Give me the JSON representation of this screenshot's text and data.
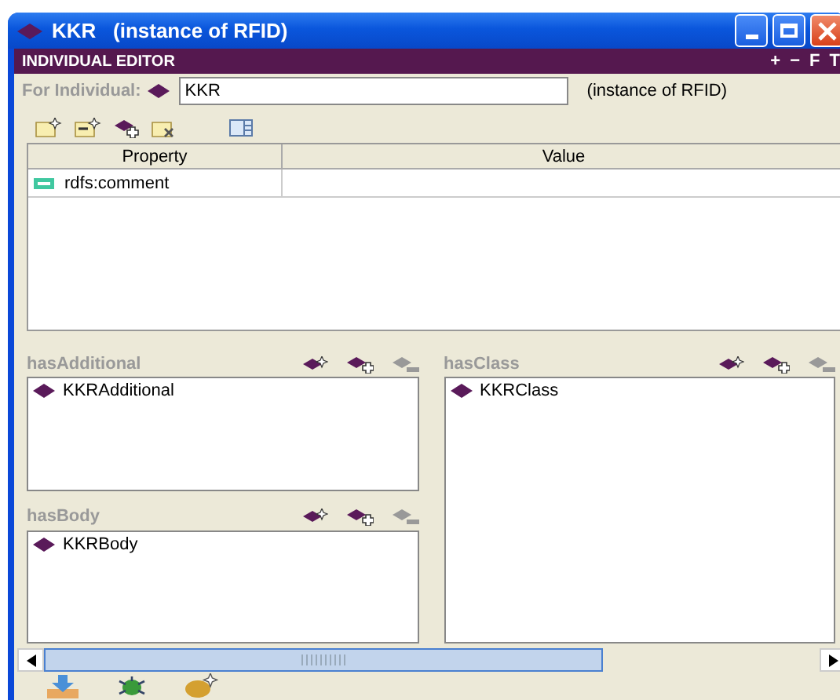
{
  "window": {
    "title": "KKR   (instance of RFID)"
  },
  "editor_header": {
    "title": "INDIVIDUAL EDITOR",
    "buttons": [
      "+",
      "−",
      "F",
      "T"
    ]
  },
  "individual": {
    "label": "For Individual:",
    "value": "KKR",
    "type_note": "(instance of RFID)"
  },
  "table": {
    "columns": [
      "Property",
      "Value"
    ],
    "rows": [
      {
        "property": "rdfs:comment",
        "value": ""
      }
    ]
  },
  "panels": [
    {
      "title": "hasAdditional",
      "items": [
        "KKRAdditional"
      ]
    },
    {
      "title": "hasClass",
      "items": [
        "KKRClass"
      ]
    },
    {
      "title": "hasBody",
      "items": [
        "KKRBody"
      ]
    }
  ]
}
